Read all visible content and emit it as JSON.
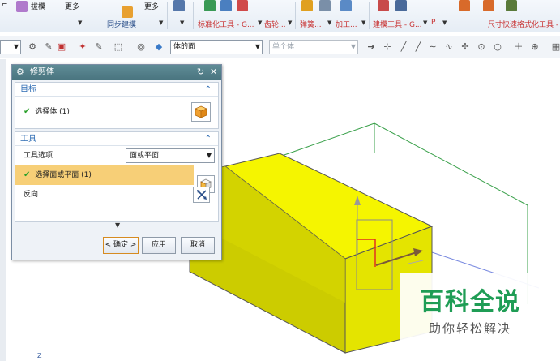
{
  "ribbon": {
    "top_labels": [
      "拔模",
      "更多",
      "更多"
    ],
    "group_labels": {
      "sync": "同步建模",
      "std_tools": "标准化工具 - G...",
      "gear": "齿轮...",
      "spring": "弹簧...",
      "machining": "加工...",
      "modeling_tools": "建模工具 - G...",
      "p": "P...",
      "dimension": "尺寸快速格式化工具 -"
    }
  },
  "selection_bar": {
    "filter_value": "体的面",
    "component_value": "单个体"
  },
  "dialog": {
    "title": "修剪体",
    "sections": {
      "target": {
        "header": "目标",
        "select_body_label": "选择体 (1)"
      },
      "tool": {
        "header": "工具",
        "tool_option_label": "工具选项",
        "tool_option_value": "面或平面",
        "select_face_label": "选择面或平面 (1)",
        "reverse_label": "反向"
      }
    },
    "buttons": {
      "ok": "< 确定 >",
      "apply": "应用",
      "cancel": "取消"
    }
  },
  "watermark": {
    "title": "百科全说",
    "subtitle": "助你轻松解决"
  },
  "axis_label": "Z",
  "colors": {
    "block_yellow": "#f5f500",
    "highlight_row": "#f7cf77",
    "title_bar": "#5f8c96",
    "section_header": "#2c6bb3",
    "watermark_green": "#1f9d55"
  }
}
